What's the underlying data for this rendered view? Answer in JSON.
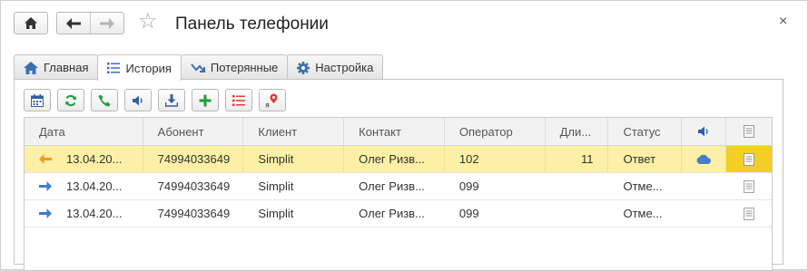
{
  "window": {
    "title": "Панель телефонии",
    "close_glyph": "×"
  },
  "tabs": [
    {
      "label": "Главная",
      "icon": "home-icon",
      "active": false
    },
    {
      "label": "История",
      "icon": "list-icon",
      "active": true
    },
    {
      "label": "Потерянные",
      "icon": "missed-call-icon",
      "active": false
    },
    {
      "label": "Настройка",
      "icon": "gear-icon",
      "active": false
    }
  ],
  "toolbar_icons": [
    "calendar-icon",
    "refresh-icon",
    "phone-icon",
    "speaker-icon",
    "download-icon",
    "add-icon",
    "list-icon",
    "yandex-map-icon"
  ],
  "table": {
    "headers": {
      "date": "Дата",
      "subscriber": "Абонент",
      "client": "Клиент",
      "contact": "Контакт",
      "operator": "Оператор",
      "duration": "Дли...",
      "status": "Статус"
    },
    "rows": [
      {
        "direction": "incoming",
        "date": "13.04.20...",
        "subscriber": "74994033649",
        "client": "Simplit",
        "contact": "Олег Ризв...",
        "operator": "102",
        "duration": "11",
        "status": "Ответ",
        "has_record": true,
        "selected": true
      },
      {
        "direction": "outgoing",
        "date": "13.04.20...",
        "subscriber": "74994033649",
        "client": "Simplit",
        "contact": "Олег Ризв...",
        "operator": "099",
        "duration": "",
        "status": "Отме...",
        "has_record": false,
        "selected": false
      },
      {
        "direction": "outgoing",
        "date": "13.04.20...",
        "subscriber": "74994033649",
        "client": "Simplit",
        "contact": "Олег Ризв...",
        "operator": "099",
        "duration": "",
        "status": "Отме...",
        "has_record": false,
        "selected": false
      }
    ]
  },
  "colors": {
    "accent_blue": "#3d7bd6",
    "incoming_arrow": "#f29a1f",
    "selected_row": "#fbf0a5",
    "selected_cell": "#f3cf25",
    "green": "#1e9e38",
    "red": "#e03a3a"
  }
}
